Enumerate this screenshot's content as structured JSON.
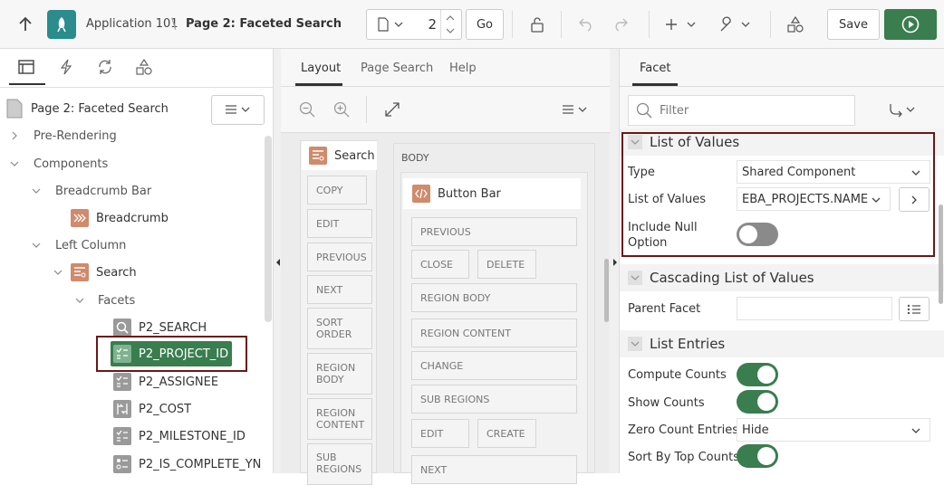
{
  "toolbar": {
    "app_name": "Application 101",
    "separator": "\\",
    "page_title": "Page 2: Faceted Search",
    "page_number": "2",
    "go_label": "Go",
    "save_label": "Save"
  },
  "left": {
    "root_label": "Page 2: Faceted Search",
    "tree": [
      {
        "label": "Pre-Rendering"
      },
      {
        "label": "Components"
      },
      {
        "label": "Breadcrumb Bar"
      },
      {
        "label": "Breadcrumb"
      },
      {
        "label": "Left Column"
      },
      {
        "label": "Search"
      },
      {
        "label": "Facets"
      },
      {
        "label": "P2_SEARCH"
      },
      {
        "label": "P2_PROJECT_ID"
      },
      {
        "label": "P2_ASSIGNEE"
      },
      {
        "label": "P2_COST"
      },
      {
        "label": "P2_MILESTONE_ID"
      },
      {
        "label": "P2_IS_COMPLETE_YN"
      }
    ]
  },
  "middle": {
    "tabs": [
      "Layout",
      "Page Search",
      "Help"
    ],
    "search_region": "Search",
    "search_buttons": [
      "COPY",
      "EDIT",
      "PREVIOUS",
      "NEXT",
      "SORT ORDER",
      "REGION BODY",
      "REGION CONTENT",
      "SUB REGIONS"
    ],
    "body_label": "BODY",
    "button_bar": "Button Bar",
    "bar_buttons": [
      "PREVIOUS",
      "CLOSE",
      "DELETE",
      "REGION BODY",
      "REGION CONTENT",
      "CHANGE",
      "SUB REGIONS",
      "EDIT",
      "CREATE",
      "NEXT"
    ]
  },
  "right": {
    "tab": "Facet",
    "filter_placeholder": "Filter",
    "sections": {
      "lov": "List of Values",
      "cascading": "Cascading List of Values",
      "entries": "List Entries"
    },
    "props": {
      "type_label": "Type",
      "type_value": "Shared Component",
      "lov_label": "List of Values",
      "lov_value": "EBA_PROJECTS.NAME",
      "null_label_1": "Include Null",
      "null_label_2": "Option",
      "parent_label": "Parent Facet",
      "compute_label": "Compute Counts",
      "show_label": "Show Counts",
      "zero_label": "Zero Count Entries",
      "zero_value": "Hide",
      "sort_label": "Sort By Top Counts"
    }
  },
  "toggles": {
    "include_null": "off",
    "compute_counts": "on",
    "show_counts": "on",
    "sort_by_top_counts": "on"
  },
  "colors": {
    "accent_green": "#3a7d4f",
    "highlight_border": "#6b1717",
    "app_icon_teal": "#2a8c8c",
    "region_icon": "#d08a6c"
  }
}
